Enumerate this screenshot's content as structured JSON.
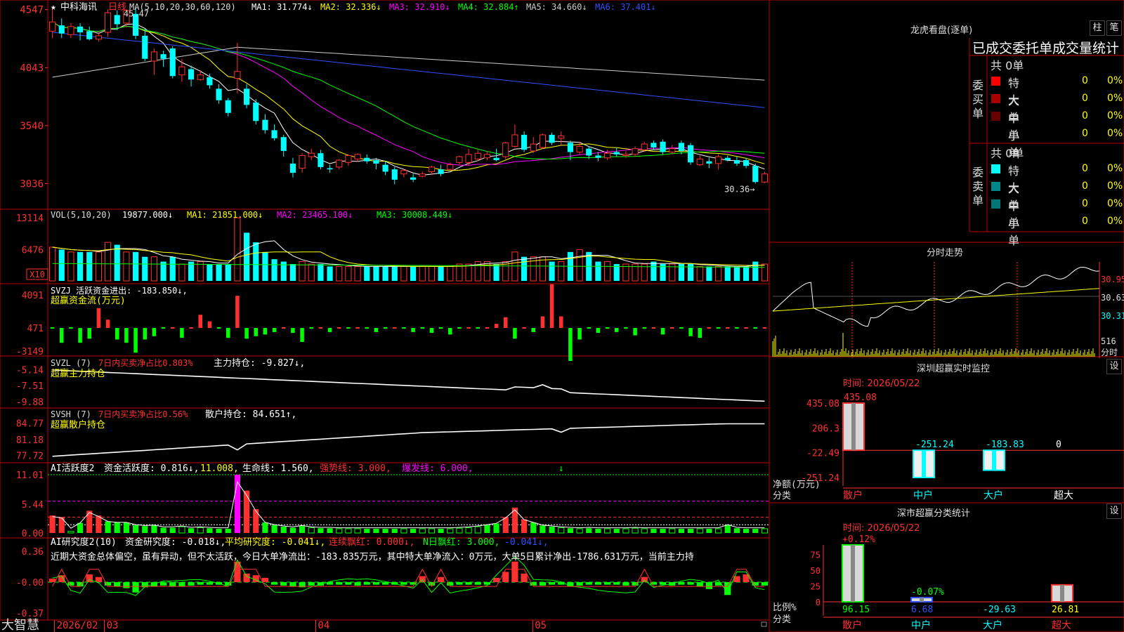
{
  "stock": {
    "star": "★",
    "name": "中科海讯",
    "period": "日线"
  },
  "main_chart": {
    "ma_header": "MA(5,10,20,30,60,120)",
    "ma_values": [
      {
        "label": "MA1: 31.774↓",
        "color": "#ffffff"
      },
      {
        "label": "MA2: 32.336↓",
        "color": "#ffff00"
      },
      {
        "label": "MA3: 32.910↓",
        "color": "#ff00ff"
      },
      {
        "label": "MA4: 32.884↑",
        "color": "#00ff00"
      },
      {
        "label": "MA5: 34.660↓",
        "color": "#cccccc"
      },
      {
        "label": "MA6: 37.401↓",
        "color": "#3050ff"
      }
    ],
    "y_ticks": [
      "4547",
      "4043",
      "3540",
      "3036"
    ],
    "high_label": "45.47",
    "low_label": "30.36→"
  },
  "vol_panel": {
    "label": "VOL(5,10,20)",
    "value": "19877.000↓",
    "ma1": "MA1: 21851.000↓",
    "ma2": "MA2: 23465.100↓",
    "ma3": "MA3: 30008.449↓",
    "y_ticks": [
      "13114",
      "6476"
    ],
    "unit": "X10"
  },
  "svzj_panel": {
    "label": "SVZJ 活跃资金进出: -183.850↓,",
    "sub": "超赢资金流(万元)",
    "y_ticks": [
      "4091",
      "471",
      "-3149"
    ]
  },
  "svzl_panel": {
    "label": "SVZL (7)",
    "text1": "7日内买卖净占比0.803%",
    "text2": "主力持仓: -9.827↓,",
    "sub": "超赢主力持仓",
    "y_ticks": [
      "-5.14",
      "-7.51",
      "-9.88"
    ]
  },
  "svsh_panel": {
    "label": "SVSH (7)",
    "text1": "7日内买卖净占比0.56%",
    "text2": "散户持仓: 84.651↑,",
    "sub": "超赢散户持仓",
    "y_ticks": [
      "84.77",
      "81.18",
      "77.72"
    ]
  },
  "ai_active": {
    "label": "AI活跃度2",
    "p1": "资金活跃度: 0.816↓,",
    "p2": "11.008,",
    "p3": "生命线: 1.560,",
    "p4": "强势线: 3.000,",
    "p5": "爆发线: 6.000,",
    "y_ticks": [
      "11.01",
      "5.44",
      "0.00"
    ]
  },
  "ai_research": {
    "label": "AI研究度2(10)",
    "p1": "资金研究度: -0.018↓,",
    "p2": "平均研究度: -0.041↓,",
    "p3": "连续飘红: 0.000↓,",
    "p4": "N日飘红: 3.000,",
    "p5": "-0.041↓,",
    "comment": "近期大资金总体偏空，虽有异动，但不太活跃，今日大单净流出：-183.835万元，其中特大单净流入：0万元，大单5日累计净出-1786.631万元，当前主力持",
    "y_ticks": [
      "0.36",
      "-0.00",
      "-0.37"
    ]
  },
  "x_axis": {
    "labels": [
      "2026/02",
      "03",
      "04",
      "05"
    ]
  },
  "brand": "大智慧",
  "right_panel": {
    "title": "龙虎看盘(逐单)",
    "btn1": "柱",
    "btn2": "笔",
    "subtitle": "已成交委托单成交量统计",
    "buy_label": "委买单",
    "sell_label": "委卖单",
    "buy_total": "共 0单",
    "sell_total": "共 0单",
    "buy_rows": [
      {
        "name": "特大",
        "count": "0",
        "pct": "0%",
        "color": "#ff0000"
      },
      {
        "name": "大单",
        "count": "0",
        "pct": "0%",
        "color": "#aa0000"
      },
      {
        "name": "中单",
        "count": "0",
        "pct": "0%",
        "color": "#660000"
      },
      {
        "name": "小单",
        "count": "0",
        "pct": "0%",
        "color": "#000000"
      }
    ],
    "sell_rows": [
      {
        "name": "特大",
        "count": "0",
        "pct": "0%",
        "color": "#00ffff"
      },
      {
        "name": "大单",
        "count": "0",
        "pct": "0%",
        "color": "#008888"
      },
      {
        "name": "中单",
        "count": "0",
        "pct": "0%",
        "color": "#007777"
      },
      {
        "name": "小单",
        "count": "0",
        "pct": "0%",
        "color": "#000000"
      }
    ],
    "intraday": {
      "title": "分时走势",
      "y_ticks": [
        "30.95",
        "30.63",
        "30.31"
      ],
      "vol_label": "516",
      "unit": "分时"
    },
    "monitor": {
      "title": "深圳超赢实时监控",
      "btn": "设",
      "time": "时间: 2026/05/22",
      "y_ticks": [
        "435.08",
        "206.3",
        "-22.49",
        "-251.24"
      ],
      "unit_label": "净额(万元)",
      "cat_label": "分类",
      "bars": [
        {
          "name": "散户",
          "value": 435.08,
          "label": "435.08"
        },
        {
          "name": "中户",
          "value": -251.24,
          "label": "-251.24"
        },
        {
          "name": "大户",
          "value": -183.83,
          "label": "-183.83"
        },
        {
          "name": "超大",
          "value": 0,
          "label": "0"
        }
      ]
    },
    "category": {
      "title": "深市超赢分类统计",
      "btn": "设",
      "time": "时间: 2026/05/22",
      "y_ticks": [
        "75",
        "50",
        "25",
        "0"
      ],
      "unit_label": "比例%",
      "cat_label": "分类",
      "bars": [
        {
          "name": "散户",
          "value": 96.15,
          "top": "+0.12%",
          "bottom": "96.15"
        },
        {
          "name": "中户",
          "value": 6.68,
          "top": "-0.07%",
          "bottom": "6.68"
        },
        {
          "name": "大户",
          "value": -29.63,
          "top": "",
          "bottom": "-29.63"
        },
        {
          "name": "超大",
          "value": 26.81,
          "top": "",
          "bottom": "26.81"
        }
      ]
    }
  },
  "chart_data": {
    "type": "candlestick",
    "title": "中科海讯 日线",
    "y_range": [
      28.5,
      46.0
    ],
    "x_labels": [
      "2026/02",
      "03",
      "04",
      "05"
    ],
    "candles": [
      [
        43.6,
        44.4,
        45.5,
        43.0
      ],
      [
        44.1,
        43.4,
        44.7,
        43.0
      ],
      [
        43.3,
        44.0,
        44.3,
        43.0
      ],
      [
        44.0,
        43.5,
        44.3,
        42.8
      ],
      [
        43.6,
        42.9,
        44.0,
        42.8
      ],
      [
        42.9,
        43.2,
        43.5,
        42.7
      ],
      [
        43.5,
        45.2,
        45.5,
        43.1
      ],
      [
        45.0,
        44.2,
        45.4,
        43.7
      ],
      [
        44.3,
        45.4,
        45.47,
        43.9
      ],
      [
        45.1,
        43.2,
        45.6,
        42.9
      ],
      [
        43.2,
        41.2,
        43.8,
        41.0
      ],
      [
        41.0,
        41.8,
        42.1,
        39.8
      ],
      [
        41.6,
        41.2,
        41.9,
        40.5
      ],
      [
        42.1,
        39.7,
        42.3,
        39.5
      ],
      [
        39.8,
        40.5,
        41.2,
        39.2
      ],
      [
        40.3,
        39.4,
        40.6,
        38.8
      ],
      [
        39.4,
        39.8,
        40.2,
        39.3
      ],
      [
        39.6,
        38.9,
        39.9,
        38.6
      ],
      [
        38.6,
        37.6,
        39.0,
        37.3
      ],
      [
        37.6,
        36.5,
        37.8,
        36.2
      ],
      [
        39.5,
        40.1,
        42.6,
        38.2
      ],
      [
        38.6,
        37.2,
        39.0,
        36.9
      ],
      [
        37.4,
        35.8,
        37.7,
        35.5
      ],
      [
        35.9,
        35.0,
        36.4,
        34.7
      ],
      [
        35.0,
        34.3,
        35.5,
        34.1
      ],
      [
        34.4,
        33.2,
        34.6,
        32.7
      ],
      [
        32.1,
        31.3,
        32.6,
        30.9
      ],
      [
        31.7,
        32.8,
        33.0,
        31.3
      ],
      [
        32.7,
        33.0,
        33.4,
        32.4
      ],
      [
        33.0,
        31.8,
        33.3,
        31.6
      ],
      [
        31.7,
        31.6,
        32.0,
        31.3
      ],
      [
        31.8,
        32.4,
        32.5,
        31.6
      ],
      [
        32.2,
        32.8,
        32.9,
        31.9
      ],
      [
        32.5,
        32.9,
        33.0,
        32.3
      ],
      [
        32.6,
        32.3,
        32.9,
        32.1
      ],
      [
        32.4,
        32.1,
        32.6,
        31.6
      ],
      [
        32.0,
        31.4,
        32.3,
        31.1
      ],
      [
        31.6,
        30.7,
        31.8,
        30.3
      ],
      [
        31.2,
        31.5,
        31.6,
        30.9
      ],
      [
        30.9,
        30.7,
        31.2,
        30.5
      ],
      [
        31.0,
        31.2,
        31.4,
        30.9
      ],
      [
        31.4,
        31.8,
        31.9,
        31.1
      ],
      [
        31.6,
        31.2,
        32.0,
        31.0
      ],
      [
        31.6,
        32.0,
        32.2,
        31.5
      ],
      [
        32.2,
        32.7,
        32.8,
        32.0
      ],
      [
        32.2,
        32.9,
        33.4,
        31.9
      ],
      [
        32.5,
        33.0,
        33.3,
        32.3
      ],
      [
        32.6,
        32.9,
        33.2,
        32.4
      ],
      [
        32.6,
        32.4,
        33.4,
        32.3
      ],
      [
        32.7,
        33.9,
        34.0,
        32.5
      ],
      [
        33.6,
        34.6,
        35.5,
        33.5
      ],
      [
        34.6,
        33.3,
        34.9,
        33.1
      ],
      [
        33.2,
        33.8,
        34.4,
        33.0
      ],
      [
        33.5,
        34.6,
        34.7,
        33.4
      ],
      [
        34.6,
        33.9,
        34.8,
        33.7
      ],
      [
        34.3,
        34.5,
        34.9,
        33.7
      ],
      [
        33.9,
        33.1,
        34.1,
        32.4
      ],
      [
        33.1,
        33.6,
        34.0,
        32.9
      ],
      [
        33.4,
        32.8,
        33.6,
        32.5
      ],
      [
        32.8,
        32.6,
        33.1,
        32.3
      ],
      [
        32.6,
        33.0,
        33.3,
        32.4
      ],
      [
        33.1,
        32.9,
        33.5,
        32.7
      ],
      [
        32.8,
        32.9,
        33.2,
        32.6
      ],
      [
        32.9,
        33.4,
        33.6,
        32.7
      ],
      [
        33.3,
        33.8,
        34.0,
        33.1
      ],
      [
        33.9,
        33.5,
        34.1,
        33.3
      ],
      [
        34.0,
        33.1,
        34.2,
        32.9
      ],
      [
        33.1,
        33.4,
        33.7,
        32.9
      ],
      [
        33.9,
        33.2,
        34.1,
        32.9
      ],
      [
        33.7,
        32.2,
        33.9,
        32.0
      ],
      [
        32.0,
        32.5,
        32.8,
        31.9
      ],
      [
        32.3,
        32.1,
        32.6,
        31.7
      ],
      [
        32.1,
        32.7,
        32.9,
        31.6
      ],
      [
        32.6,
        32.4,
        32.8,
        32.3
      ],
      [
        32.4,
        32.1,
        32.7,
        31.9
      ],
      [
        32.4,
        31.9,
        32.6,
        31.7
      ],
      [
        31.9,
        30.5,
        32.1,
        30.36
      ],
      [
        30.5,
        31.2,
        31.4,
        30.4
      ]
    ],
    "volume": [
      7,
      6.5,
      6,
      6,
      6,
      6,
      8,
      7.5,
      6,
      6,
      5,
      5,
      4,
      5,
      3.5,
      4,
      4,
      3.5,
      3.5,
      3.5,
      13.1,
      10,
      8,
      6,
      4.5,
      4,
      3.5,
      4,
      3.5,
      3.5,
      3,
      3,
      3,
      3,
      3,
      3,
      3,
      3,
      3,
      3,
      3,
      3,
      3,
      3,
      3.5,
      3.5,
      4,
      4,
      3.5,
      4,
      6,
      5,
      5,
      5,
      4,
      4,
      6,
      6.5,
      6,
      4,
      4,
      3.5,
      3.5,
      3.5,
      3.5,
      4,
      3.5,
      3.5,
      3.5,
      3.5,
      3,
      3,
      3,
      3,
      3,
      3,
      4,
      3.5
    ],
    "svzj": [
      0,
      -1.8,
      0,
      -1.8,
      -1.3,
      2.4,
      1,
      -1.4,
      -1.8,
      -3.0,
      -1.4,
      -1.0,
      0,
      0,
      -1.2,
      0,
      1.6,
      0.8,
      0,
      -1.2,
      3.9,
      -1.3,
      -1,
      -0.8,
      -0.5,
      0,
      -0.6,
      -1.7,
      0,
      0,
      -0.5,
      0,
      0,
      0,
      0,
      -0.5,
      0,
      0,
      0,
      -0.5,
      0,
      -0.6,
      0,
      -0.8,
      0,
      0,
      0,
      0,
      0.5,
      1.3,
      -1.3,
      0,
      -0.5,
      1.4,
      5.3,
      1.4,
      -4.0,
      -1.4,
      0,
      -0.6,
      0,
      -0.5,
      0,
      -0.9,
      0,
      0,
      -0.8,
      0,
      0,
      -1.0,
      -1.2,
      0,
      0,
      0,
      0,
      0,
      0,
      0
    ],
    "svzl_range": [
      -10.2,
      -5.0
    ],
    "svsh_range": [
      77.0,
      85.5
    ],
    "ai_active": [
      3.3,
      3.0,
      0.3,
      1.9,
      4.2,
      3.3,
      2.2,
      2.0,
      2.0,
      1.5,
      1.3,
      1.4,
      1.0,
      1.0,
      1.2,
      0.9,
      1.0,
      0.9,
      0.8,
      0.8,
      11.0,
      8.0,
      4.5,
      2.0,
      1.5,
      1.2,
      1.0,
      1.3,
      1.0,
      0.9,
      0.9,
      0.8,
      0.8,
      0.8,
      0.8,
      0.8,
      0.8,
      0.8,
      0.8,
      0.8,
      0.8,
      0.8,
      0.8,
      0.8,
      0.9,
      1.0,
      1.2,
      1.5,
      1.8,
      3.0,
      4.8,
      2.6,
      2.0,
      1.4,
      1.2,
      1.0,
      0.9,
      0.8,
      0.9,
      0.8,
      0.8,
      0.8,
      0.8,
      0.9,
      0.8,
      0.8,
      0.8,
      0.8,
      0.8,
      0.8,
      0.8,
      0.8,
      0.8,
      1.5,
      0.9,
      0.8,
      0.8,
      0.8
    ],
    "ai_research": [
      0.04,
      0.08,
      -0.04,
      -0.05,
      0.09,
      0.06,
      -0.04,
      -0.05,
      -0.07,
      -0.12,
      -0.06,
      -0.05,
      -0.04,
      -0.05,
      -0.05,
      -0.04,
      -0.03,
      -0.03,
      -0.03,
      -0.04,
      0.24,
      0.1,
      0.08,
      0.05,
      -0.03,
      -0.04,
      -0.05,
      -0.06,
      -0.04,
      -0.04,
      -0.03,
      -0.03,
      -0.03,
      -0.04,
      -0.03,
      -0.03,
      -0.03,
      -0.03,
      -0.03,
      -0.03,
      0.07,
      -0.04,
      0.06,
      -0.04,
      -0.03,
      -0.03,
      -0.03,
      -0.03,
      0.05,
      0.12,
      0.24,
      0.1,
      -0.04,
      -0.04,
      -0.03,
      -0.03,
      -0.05,
      -0.04,
      -0.03,
      -0.03,
      -0.03,
      -0.03,
      -0.04,
      -0.04,
      0.06,
      -0.03,
      -0.03,
      -0.04,
      -0.03,
      -0.03,
      -0.05,
      -0.08,
      -0.04,
      -0.15,
      0.07,
      0.09,
      -0.04,
      -0.04
    ],
    "monitor_bars": [
      435.08,
      -251.24,
      -183.83,
      0
    ],
    "category_bars": [
      96.15,
      6.68,
      -29.63,
      26.81
    ]
  }
}
